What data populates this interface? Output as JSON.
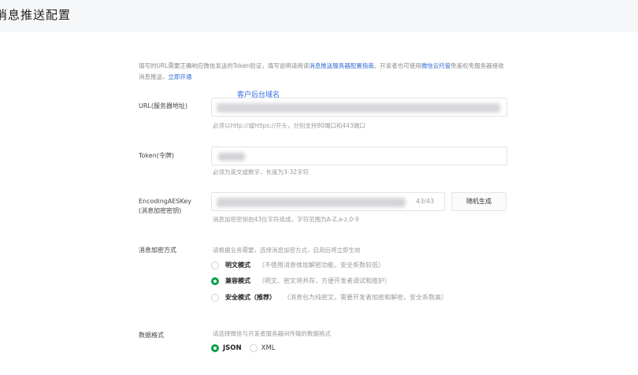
{
  "header": {
    "title": "消息推送配置"
  },
  "intro": {
    "text_before": "填写的URL需要正确响应微信发送的Token验证，填写说明请阅读",
    "guide_link": "消息推送服务器配置指南",
    "text_middle": "。开发者也可使用",
    "hosting_link": "微信云托管",
    "text_after": "免鉴权免服务器接收消息推送，",
    "open_link": "立即开通"
  },
  "annotation": "客户后台域名",
  "url_field": {
    "label": "URL(服务器地址)",
    "hint": "必须以http://或https://开头，分别支持80端口和443端口"
  },
  "token_field": {
    "label": "Token(令牌)",
    "hint": "必须为英文或数字，长度为3-32字符"
  },
  "aes_field": {
    "label_line1": "EncodingAESKey",
    "label_line2": "(消息加密密钥)",
    "counter": "43/43",
    "generate_button": "随机生成",
    "hint": "消息加密密钥由43位字符组成，字符范围为A-Z,a-z,0-9"
  },
  "encryption": {
    "label": "消息加密方式",
    "hint": "请根据业务需要，选择消息加密方式，启用后将立即生效",
    "options": [
      {
        "name": "明文模式",
        "desc": "（不使用消息体加解密功能，安全系数较低）",
        "checked": false
      },
      {
        "name": "兼容模式",
        "desc": "（明文、密文将共存，方便开发者调试和维护）",
        "checked": true
      },
      {
        "name": "安全模式（推荐）",
        "desc": "（消息包为纯密文，需要开发者加密和解密，安全系数高）",
        "checked": false
      }
    ]
  },
  "data_format": {
    "label": "数据格式",
    "hint": "请选择微信与开发者服务器间传输的数据格式",
    "options": [
      {
        "name": "JSON",
        "checked": true
      },
      {
        "name": "XML",
        "checked": false
      }
    ]
  },
  "colors": {
    "accent_green": "#07a14a",
    "link_blue": "#2f6ad0",
    "annotation_blue": "#2e6be6"
  }
}
